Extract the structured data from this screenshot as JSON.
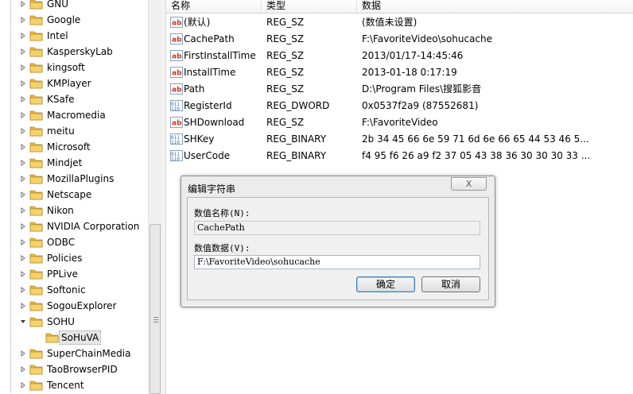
{
  "tree": {
    "items": [
      {
        "label": "GNU"
      },
      {
        "label": "Google"
      },
      {
        "label": "Intel"
      },
      {
        "label": "KasperskyLab"
      },
      {
        "label": "kingsoft"
      },
      {
        "label": "KMPlayer"
      },
      {
        "label": "KSafe"
      },
      {
        "label": "Macromedia"
      },
      {
        "label": "meitu"
      },
      {
        "label": "Microsoft"
      },
      {
        "label": "Mindjet"
      },
      {
        "label": "MozillaPlugins"
      },
      {
        "label": "Netscape"
      },
      {
        "label": "Nikon"
      },
      {
        "label": "NVIDIA Corporation"
      },
      {
        "label": "ODBC"
      },
      {
        "label": "Policies"
      },
      {
        "label": "PPLive"
      },
      {
        "label": "Softonic"
      },
      {
        "label": "SogouExplorer"
      },
      {
        "label": "SOHU",
        "expanded": true
      },
      {
        "label": "SoHuVA",
        "child": true,
        "selected": true
      },
      {
        "label": "SuperChainMedia"
      },
      {
        "label": "TaoBrowserPID"
      },
      {
        "label": "Tencent"
      }
    ]
  },
  "list": {
    "columns": [
      "名称",
      "类型",
      "数据"
    ],
    "rows": [
      {
        "icon": "string-value-icon",
        "name": "(默认)",
        "type": "REG_SZ",
        "data": "(数值未设置)"
      },
      {
        "icon": "string-value-icon",
        "name": "CachePath",
        "type": "REG_SZ",
        "data": "F:\\FavoriteVideo\\sohucache"
      },
      {
        "icon": "string-value-icon",
        "name": "FirstInstallTime",
        "type": "REG_SZ",
        "data": "2013/01/17-14:45:46"
      },
      {
        "icon": "string-value-icon",
        "name": "InstallTime",
        "type": "REG_SZ",
        "data": "2013-01-18 0:17:19"
      },
      {
        "icon": "string-value-icon",
        "name": "Path",
        "type": "REG_SZ",
        "data": "D:\\Program Files\\搜狐影音"
      },
      {
        "icon": "binary-value-icon",
        "name": "RegisterId",
        "type": "REG_DWORD",
        "data": "0x0537f2a9 (87552681)"
      },
      {
        "icon": "string-value-icon",
        "name": "SHDownload",
        "type": "REG_SZ",
        "data": "F:\\FavoriteVideo"
      },
      {
        "icon": "binary-value-icon",
        "name": "SHKey",
        "type": "REG_BINARY",
        "data": "2b 34 45 66 6e 59 71 6d 6e 66 65 44 53 46 5..."
      },
      {
        "icon": "binary-value-icon",
        "name": "UserCode",
        "type": "REG_BINARY",
        "data": "f4 95 f6 26 a9 f2 37 05 43 38 36 30 30 30 33 ..."
      }
    ]
  },
  "dialog": {
    "title": "编辑字符串",
    "close_label": "X",
    "name_label": "数值名称(N):",
    "name_value": "CachePath",
    "data_label": "数值数据(V):",
    "data_value": "F:\\FavoriteVideo\\sohucache",
    "ok_label": "确定",
    "cancel_label": "取消"
  },
  "colors": {
    "folder_yellow": "#e8b93c",
    "string_icon_red": "#c0392b",
    "binary_icon_blue": "#3a6fb0"
  }
}
